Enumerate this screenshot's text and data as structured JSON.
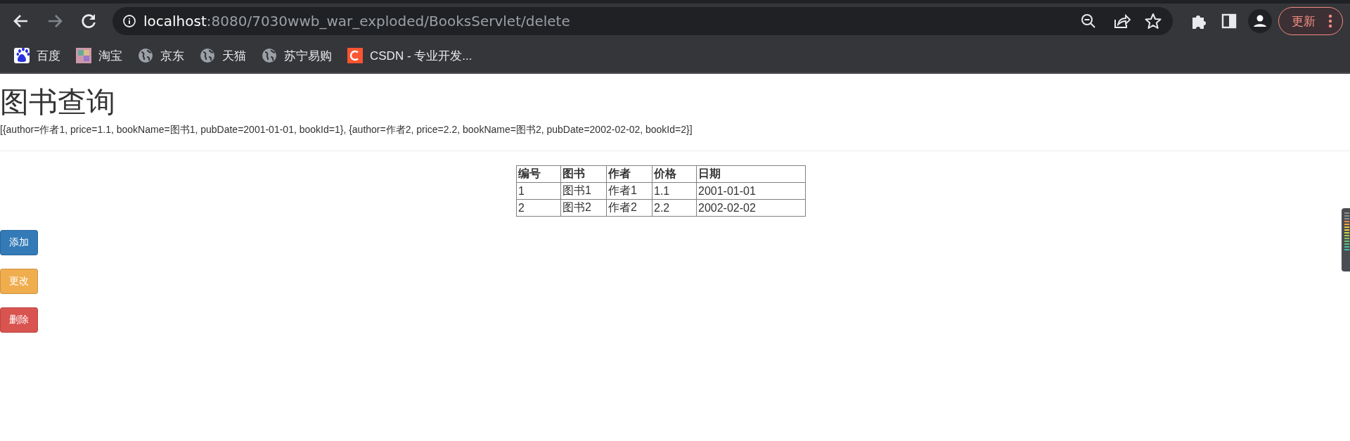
{
  "browser": {
    "address_host": "localhost",
    "address_rest": ":8080/7030wwb_war_exploded/BooksServlet/delete",
    "update_button": "更新",
    "bookmarks": [
      {
        "kind": "baidu",
        "label": "百度"
      },
      {
        "kind": "taobao",
        "label": "淘宝"
      },
      {
        "kind": "globe",
        "label": "京东"
      },
      {
        "kind": "globe",
        "label": "天猫"
      },
      {
        "kind": "globe",
        "label": "苏宁易购"
      },
      {
        "kind": "csdn",
        "label": "CSDN - 专业开发..."
      }
    ]
  },
  "page": {
    "title": "图书查询",
    "data_text": "[{author=作者1, price=1.1, bookName=图书1, pubDate=2001-01-01, bookId=1}, {author=作者2, price=2.2, bookName=图书2, pubDate=2002-02-02, bookId=2}]",
    "table": {
      "columns": [
        "编号",
        "图书",
        "作者",
        "价格",
        "日期"
      ],
      "rows": [
        [
          "1",
          "图书1",
          "作者1",
          "1.1",
          "2001-01-01"
        ],
        [
          "2",
          "图书2",
          "作者2",
          "2.2",
          "2002-02-02"
        ]
      ]
    },
    "buttons": [
      {
        "kind": "primary",
        "label": "添加"
      },
      {
        "kind": "warning",
        "label": "更改"
      },
      {
        "kind": "danger",
        "label": "删除"
      }
    ]
  }
}
